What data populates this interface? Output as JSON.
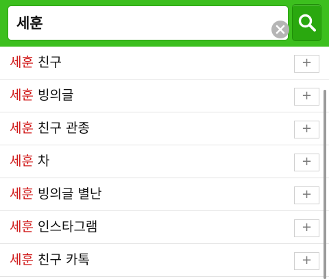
{
  "search": {
    "query": "세훈",
    "clear_icon": "clear-x-icon",
    "search_icon": "magnifier-icon"
  },
  "colors": {
    "header_green": "#3cbf1e",
    "button_green": "#2aa80f",
    "highlight_red": "#d01a1a"
  },
  "suggestions": [
    {
      "match": "세훈",
      "rest": " 친구",
      "add_label": "+"
    },
    {
      "match": "세훈",
      "rest": " 빙의글",
      "add_label": "+"
    },
    {
      "match": "세훈",
      "rest": " 친구 관종",
      "add_label": "+"
    },
    {
      "match": "세훈",
      "rest": " 차",
      "add_label": "+"
    },
    {
      "match": "세훈",
      "rest": " 빙의글 별난",
      "add_label": "+"
    },
    {
      "match": "세훈",
      "rest": " 인스타그램",
      "add_label": "+"
    },
    {
      "match": "세훈",
      "rest": " 친구 카톡",
      "add_label": "+"
    }
  ]
}
